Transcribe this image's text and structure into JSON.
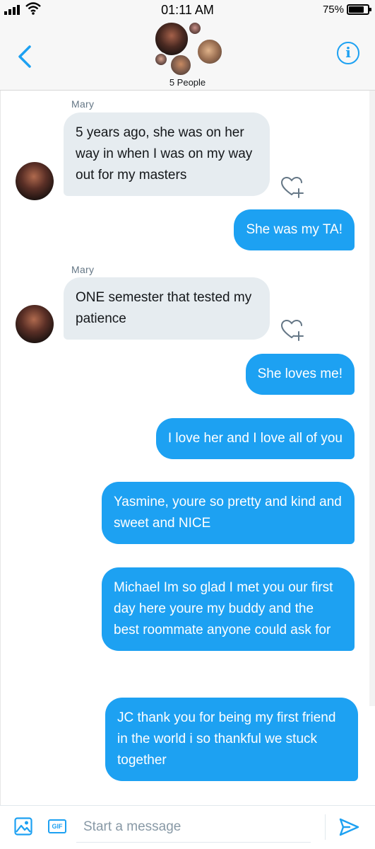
{
  "status_bar": {
    "time": "01:11 AM",
    "battery": "75%"
  },
  "header": {
    "participants": "5 People",
    "back_icon": "chevron-left-icon",
    "info_icon": "info-icon",
    "info_glyph": "i"
  },
  "conversation": {
    "incoming": [
      {
        "sender": "Mary",
        "text": "5 years ago, she was on her way in when I was on my way out for my masters"
      },
      {
        "sender": "Mary",
        "text": "ONE semester that tested my patience"
      }
    ],
    "outgoing": [
      "She was my TA!",
      "She loves me!",
      "I love her and I love all of you",
      "Yasmine, youre so pretty and kind and sweet and NICE",
      "Michael Im so glad I met you our first day here youre my buddy and the best roommate anyone could ask for",
      "JC thank you for being my first friend in the world i so thankful we stuck together"
    ]
  },
  "composer": {
    "placeholder": "Start a message",
    "gif_label": "GIF",
    "media_icon": "image-icon",
    "send_icon": "send-icon"
  },
  "colors": {
    "accent": "#1da1f2",
    "incoming_bubble": "#e6ecf0",
    "header_bg": "#f7f7f7"
  }
}
